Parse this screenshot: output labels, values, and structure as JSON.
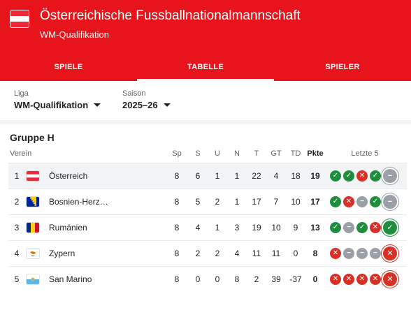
{
  "header": {
    "title": "Österreichische Fussballnationalmannschaft",
    "subtitle": "WM-Qualifikation",
    "bg_color": "#e8141b"
  },
  "tabs": [
    {
      "label": "SPIELE",
      "active": false
    },
    {
      "label": "TABELLE",
      "active": true
    },
    {
      "label": "SPIELER",
      "active": false
    }
  ],
  "filters": {
    "league": {
      "label": "Liga",
      "value": "WM-Qualifikation"
    },
    "season": {
      "label": "Saison",
      "value": "2025–26"
    }
  },
  "table": {
    "group": "Gruppe H",
    "columns": {
      "team": "Verein",
      "sp": "Sp",
      "s": "S",
      "u": "U",
      "n": "N",
      "t": "T",
      "gt": "GT",
      "td": "TD",
      "pkte": "Pkte",
      "form": "Letzte 5"
    },
    "rows": [
      {
        "pos": "1",
        "team": "Österreich",
        "flag": "austria-flag-icon",
        "sp": "8",
        "s": "6",
        "u": "1",
        "n": "1",
        "t": "22",
        "gt": "4",
        "td": "18",
        "pkte": "19",
        "form": [
          "W",
          "W",
          "L",
          "W",
          "D"
        ]
      },
      {
        "pos": "2",
        "team": "Bosnien-Herz…",
        "flag": "bosnia-flag-icon",
        "sp": "8",
        "s": "5",
        "u": "2",
        "n": "1",
        "t": "17",
        "gt": "7",
        "td": "10",
        "pkte": "17",
        "form": [
          "W",
          "L",
          "D",
          "W",
          "D"
        ]
      },
      {
        "pos": "3",
        "team": "Rumänien",
        "flag": "romania-flag-icon",
        "sp": "8",
        "s": "4",
        "u": "1",
        "n": "3",
        "t": "19",
        "gt": "10",
        "td": "9",
        "pkte": "13",
        "form": [
          "W",
          "D",
          "W",
          "L",
          "W"
        ]
      },
      {
        "pos": "4",
        "team": "Zypern",
        "flag": "cyprus-flag-icon",
        "sp": "8",
        "s": "2",
        "u": "2",
        "n": "4",
        "t": "11",
        "gt": "11",
        "td": "0",
        "pkte": "8",
        "form": [
          "L",
          "D",
          "D",
          "D",
          "L"
        ]
      },
      {
        "pos": "5",
        "team": "San Marino",
        "flag": "san-marino-flag-icon",
        "sp": "8",
        "s": "0",
        "u": "0",
        "n": "8",
        "t": "2",
        "gt": "39",
        "td": "-37",
        "pkte": "0",
        "form": [
          "L",
          "L",
          "L",
          "L",
          "L"
        ]
      }
    ]
  },
  "colors": {
    "win": "#1e8e3e",
    "loss": "#d93025",
    "draw": "#9aa0a6"
  }
}
